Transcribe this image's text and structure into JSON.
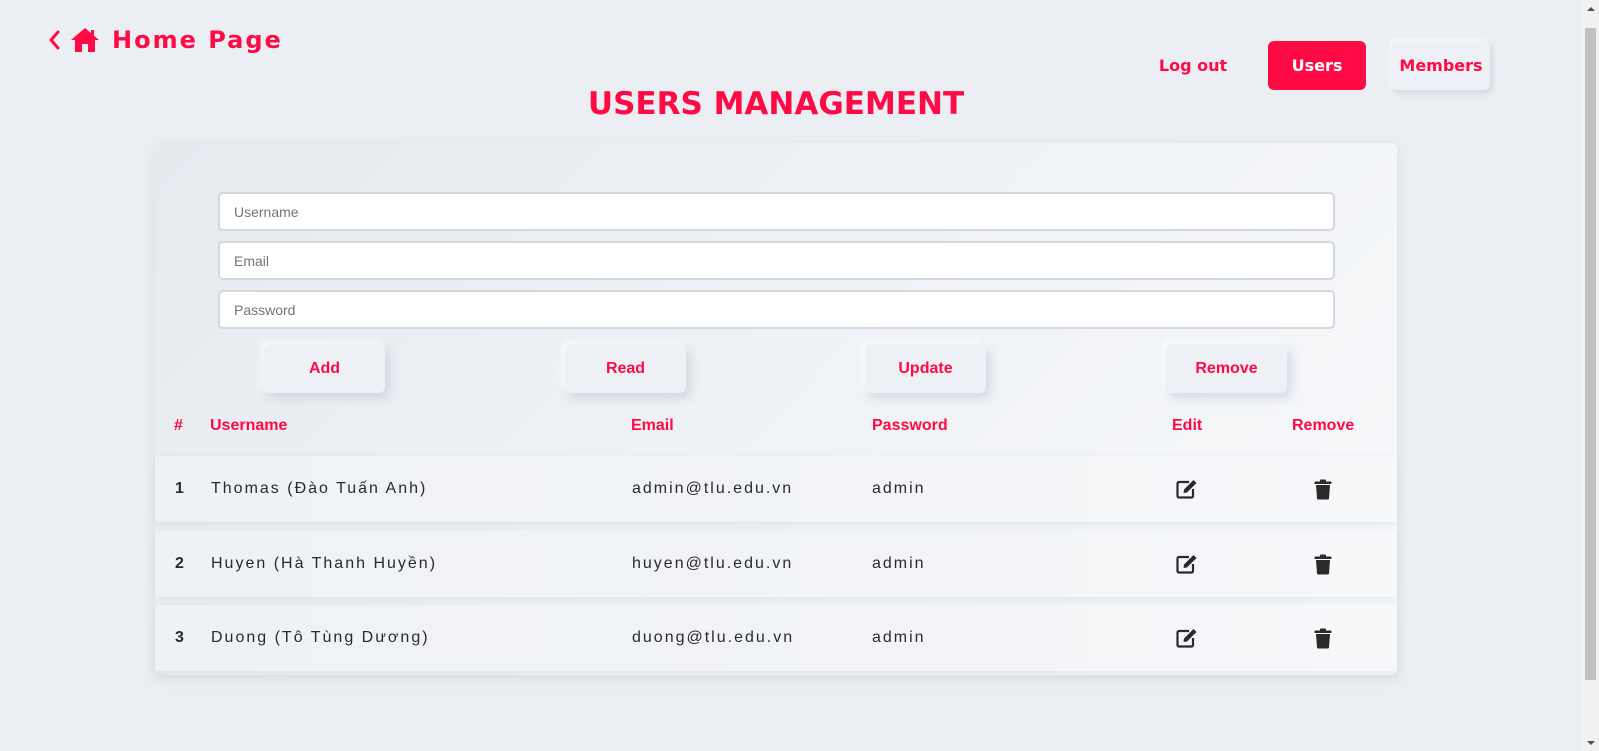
{
  "header": {
    "home_label": "Home Page",
    "title": "USERS MANAGEMENT"
  },
  "nav": {
    "logout": "Log out",
    "users": "Users",
    "members": "Members",
    "active": "Users"
  },
  "form": {
    "username_placeholder": "Username",
    "email_placeholder": "Email",
    "password_placeholder": "Password"
  },
  "actions": {
    "add": "Add",
    "read": "Read",
    "update": "Update",
    "remove": "Remove"
  },
  "table": {
    "columns": [
      "#",
      "Username",
      "Email",
      "Password",
      "Edit",
      "Remove"
    ],
    "rows": [
      {
        "num": "1",
        "username": "Thomas (Đào Tuấn Anh)",
        "email": "admin@tlu.edu.vn",
        "password": "admin"
      },
      {
        "num": "2",
        "username": "Huyen (Hà Thanh Huyền)",
        "email": "huyen@tlu.edu.vn",
        "password": "admin"
      },
      {
        "num": "3",
        "username": "Duong (Tô Tùng Dương)",
        "email": "duong@tlu.edu.vn",
        "password": "admin"
      }
    ]
  },
  "icons": {
    "back": "chevron-left-icon",
    "home": "home-icon",
    "edit": "edit-icon",
    "delete": "trash-icon"
  },
  "colors": {
    "accent": "#ff0a45",
    "background": "#ebeef2",
    "text": "#2a2a2a"
  }
}
